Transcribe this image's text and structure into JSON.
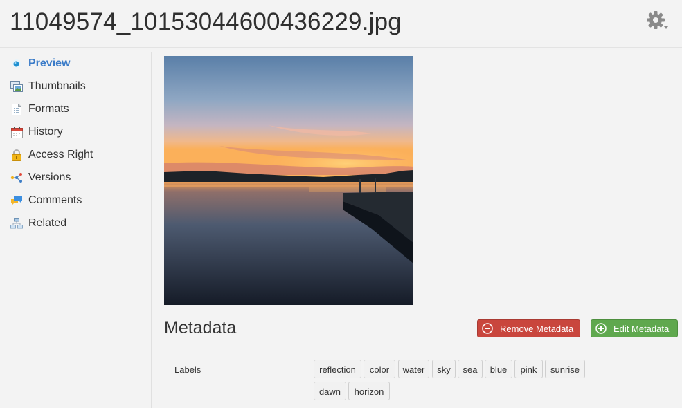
{
  "header": {
    "title": "11049574_10153044600436229.jpg",
    "settings_icon": "gear-icon"
  },
  "sidebar": {
    "items": [
      {
        "label": "Preview",
        "icon": "preview-dot-icon",
        "active": true
      },
      {
        "label": "Thumbnails",
        "icon": "thumbnails-icon"
      },
      {
        "label": "Formats",
        "icon": "formats-icon"
      },
      {
        "label": "History",
        "icon": "calendar-icon"
      },
      {
        "label": "Access Right",
        "icon": "lock-icon"
      },
      {
        "label": "Versions",
        "icon": "versions-icon"
      },
      {
        "label": "Comments",
        "icon": "comments-icon"
      },
      {
        "label": "Related",
        "icon": "related-icon"
      }
    ]
  },
  "metadata": {
    "title": "Metadata",
    "remove_label": "Remove Metadata",
    "edit_label": "Edit Metadata",
    "labels_key": "Labels",
    "tags": [
      "reflection",
      "color",
      "water",
      "sky",
      "sea",
      "blue",
      "pink",
      "sunrise",
      "dawn",
      "horizon"
    ]
  },
  "colors": {
    "active_link": "#3a7bc8",
    "remove_button": "#c9463d",
    "edit_button": "#5fa84e"
  }
}
